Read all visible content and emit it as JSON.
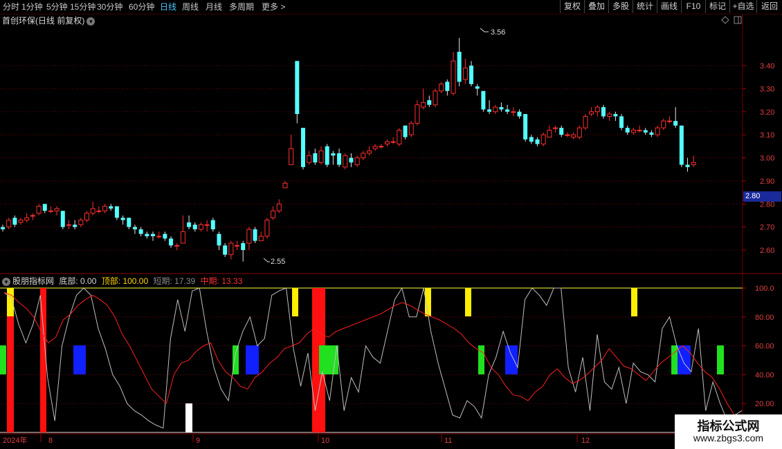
{
  "toolbar": {
    "periods": [
      "分时",
      "1分钟",
      "5分钟",
      "15分钟",
      "30分钟",
      "60分钟",
      "日线",
      "周线",
      "月线",
      "多周期",
      "更多 >"
    ],
    "active_period": "日线",
    "buttons": [
      "复权",
      "叠加",
      "多股",
      "统计",
      "画线",
      "F10",
      "标记",
      "+自选",
      "返回"
    ]
  },
  "stock_title": "首创环保(日线 前复权)",
  "price_axis": [
    "3.40",
    "3.30",
    "3.20",
    "3.10",
    "3.00",
    "2.90",
    "2.80",
    "2.70",
    "2.60"
  ],
  "current_price": "2.80",
  "annotations": {
    "high": "3.56",
    "low": "2.55"
  },
  "indicator": {
    "name": "股朋指标网",
    "bottom_label": "底部:",
    "bottom_value": "0.00",
    "top_label": "顶部:",
    "top_value": "100.00",
    "short_label": "短期:",
    "short_value": "17.39",
    "mid_label": "中期:",
    "mid_value": "13.33",
    "axis": [
      "100.0",
      "80.00",
      "60.00",
      "40.00",
      "20.00"
    ]
  },
  "date_axis": [
    "2024年",
    "8",
    "9",
    "10",
    "11",
    "12"
  ],
  "watermark": {
    "line1": "指标公式网",
    "line2": "www.zbgs3.com"
  },
  "colors": {
    "up": "#ff3030",
    "down": "#54ffff",
    "short_line": "#c0c0c0",
    "mid_line": "#ff2020",
    "accent": "#4fc3f7"
  },
  "candles": [
    [
      2.7,
      2.69,
      2.71,
      2.68
    ],
    [
      2.7,
      2.73,
      2.74,
      2.69
    ],
    [
      2.74,
      2.71,
      2.75,
      2.7
    ],
    [
      2.72,
      2.73,
      2.74,
      2.71
    ],
    [
      2.73,
      2.74,
      2.76,
      2.72
    ],
    [
      2.75,
      2.75,
      2.76,
      2.73
    ],
    [
      2.76,
      2.79,
      2.8,
      2.75
    ],
    [
      2.8,
      2.77,
      2.8,
      2.76
    ],
    [
      2.77,
      2.77,
      2.79,
      2.76
    ],
    [
      2.77,
      2.78,
      2.79,
      2.75
    ],
    [
      2.77,
      2.7,
      2.77,
      2.69
    ],
    [
      2.71,
      2.71,
      2.73,
      2.69
    ],
    [
      2.71,
      2.7,
      2.73,
      2.69
    ],
    [
      2.71,
      2.73,
      2.74,
      2.7
    ],
    [
      2.73,
      2.76,
      2.77,
      2.72
    ],
    [
      2.76,
      2.78,
      2.81,
      2.75
    ],
    [
      2.77,
      2.77,
      2.79,
      2.76
    ],
    [
      2.77,
      2.79,
      2.8,
      2.76
    ],
    [
      2.79,
      2.78,
      2.8,
      2.77
    ],
    [
      2.79,
      2.74,
      2.79,
      2.73
    ],
    [
      2.74,
      2.73,
      2.75,
      2.71
    ],
    [
      2.74,
      2.7,
      2.74,
      2.69
    ],
    [
      2.7,
      2.69,
      2.71,
      2.67
    ],
    [
      2.69,
      2.67,
      2.7,
      2.66
    ],
    [
      2.67,
      2.66,
      2.68,
      2.65
    ],
    [
      2.67,
      2.66,
      2.68,
      2.64
    ],
    [
      2.66,
      2.66,
      2.68,
      2.65
    ],
    [
      2.67,
      2.65,
      2.68,
      2.64
    ],
    [
      2.65,
      2.62,
      2.66,
      2.61
    ],
    [
      2.62,
      2.62,
      2.63,
      2.6
    ],
    [
      2.63,
      2.68,
      2.75,
      2.63
    ],
    [
      2.72,
      2.7,
      2.75,
      2.69
    ],
    [
      2.71,
      2.69,
      2.72,
      2.68
    ],
    [
      2.69,
      2.71,
      2.72,
      2.68
    ],
    [
      2.71,
      2.71,
      2.73,
      2.68
    ],
    [
      2.73,
      2.69,
      2.74,
      2.68
    ],
    [
      2.67,
      2.62,
      2.68,
      2.6
    ],
    [
      2.62,
      2.58,
      2.63,
      2.57
    ],
    [
      2.58,
      2.63,
      2.64,
      2.56
    ],
    [
      2.62,
      2.62,
      2.64,
      2.6
    ],
    [
      2.63,
      2.6,
      2.64,
      2.55
    ],
    [
      2.63,
      2.69,
      2.7,
      2.6
    ],
    [
      2.69,
      2.64,
      2.7,
      2.63
    ],
    [
      2.64,
      2.66,
      2.68,
      2.64
    ],
    [
      2.66,
      2.73,
      2.74,
      2.65
    ],
    [
      2.74,
      2.77,
      2.79,
      2.73
    ],
    [
      2.77,
      2.8,
      2.82,
      2.76
    ],
    [
      2.87,
      2.89,
      2.9,
      2.87
    ],
    [
      2.97,
      3.04,
      3.1,
      2.97
    ],
    [
      3.42,
      3.19,
      3.42,
      3.15
    ],
    [
      3.13,
      2.96,
      3.13,
      2.95
    ],
    [
      2.98,
      3.01,
      3.03,
      2.97
    ],
    [
      3.02,
      2.98,
      3.04,
      2.97
    ],
    [
      2.98,
      3.03,
      3.05,
      2.97
    ],
    [
      3.05,
      2.97,
      3.06,
      2.96
    ],
    [
      3.02,
      3.01,
      3.03,
      2.97
    ],
    [
      3.02,
      2.97,
      3.04,
      2.96
    ],
    [
      2.96,
      3.01,
      3.02,
      2.95
    ],
    [
      3.0,
      2.98,
      3.02,
      2.96
    ],
    [
      2.97,
      3.0,
      3.01,
      2.96
    ],
    [
      3.0,
      3.02,
      3.03,
      2.99
    ],
    [
      3.02,
      3.03,
      3.05,
      3.01
    ],
    [
      3.04,
      3.05,
      3.06,
      3.03
    ],
    [
      3.05,
      3.05,
      3.06,
      3.04
    ],
    [
      3.06,
      3.07,
      3.08,
      3.05
    ],
    [
      3.07,
      3.07,
      3.09,
      3.06
    ],
    [
      3.06,
      3.12,
      3.13,
      3.05
    ],
    [
      3.14,
      3.09,
      3.14,
      3.08
    ],
    [
      3.1,
      3.15,
      3.16,
      3.09
    ],
    [
      3.15,
      3.23,
      3.25,
      3.14
    ],
    [
      3.22,
      3.24,
      3.3,
      3.21
    ],
    [
      3.25,
      3.23,
      3.27,
      3.22
    ],
    [
      3.23,
      3.29,
      3.3,
      3.22
    ],
    [
      3.29,
      3.32,
      3.33,
      3.28
    ],
    [
      3.33,
      3.29,
      3.34,
      3.27
    ],
    [
      3.28,
      3.42,
      3.46,
      3.27
    ],
    [
      3.46,
      3.33,
      3.52,
      3.31
    ],
    [
      3.34,
      3.39,
      3.43,
      3.32
    ],
    [
      3.4,
      3.32,
      3.42,
      3.31
    ],
    [
      3.31,
      3.3,
      3.32,
      3.27
    ],
    [
      3.29,
      3.21,
      3.29,
      3.2
    ],
    [
      3.21,
      3.2,
      3.25,
      3.19
    ],
    [
      3.2,
      3.22,
      3.23,
      3.19
    ],
    [
      3.22,
      3.21,
      3.24,
      3.2
    ],
    [
      3.21,
      3.2,
      3.23,
      3.19
    ],
    [
      3.2,
      3.2,
      3.22,
      3.18
    ],
    [
      3.2,
      3.18,
      3.21,
      3.17
    ],
    [
      3.19,
      3.08,
      3.19,
      3.07
    ],
    [
      3.09,
      3.07,
      3.1,
      3.06
    ],
    [
      3.08,
      3.06,
      3.09,
      3.05
    ],
    [
      3.06,
      3.1,
      3.11,
      3.05
    ],
    [
      3.09,
      3.12,
      3.14,
      3.09
    ],
    [
      3.13,
      3.13,
      3.14,
      3.11
    ],
    [
      3.13,
      3.1,
      3.14,
      3.09
    ],
    [
      3.1,
      3.1,
      3.11,
      3.09
    ],
    [
      3.09,
      3.1,
      3.11,
      3.08
    ],
    [
      3.09,
      3.13,
      3.14,
      3.08
    ],
    [
      3.13,
      3.18,
      3.19,
      3.12
    ],
    [
      3.19,
      3.2,
      3.22,
      3.18
    ],
    [
      3.2,
      3.22,
      3.23,
      3.18
    ],
    [
      3.22,
      3.18,
      3.23,
      3.17
    ],
    [
      3.18,
      3.19,
      3.2,
      3.16
    ],
    [
      3.19,
      3.18,
      3.2,
      3.16
    ],
    [
      3.18,
      3.13,
      3.19,
      3.12
    ],
    [
      3.13,
      3.11,
      3.14,
      3.1
    ],
    [
      3.11,
      3.12,
      3.13,
      3.1
    ],
    [
      3.12,
      3.12,
      3.14,
      3.11
    ],
    [
      3.12,
      3.11,
      3.13,
      3.1
    ],
    [
      3.11,
      3.1,
      3.12,
      3.09
    ],
    [
      3.1,
      3.13,
      3.14,
      3.09
    ],
    [
      3.13,
      3.16,
      3.17,
      3.12
    ],
    [
      3.16,
      3.16,
      3.18,
      3.15
    ],
    [
      3.16,
      3.14,
      3.22,
      3.13
    ],
    [
      3.14,
      2.97,
      3.14,
      2.96
    ],
    [
      2.97,
      2.96,
      3.0,
      2.94
    ],
    [
      2.97,
      2.98,
      3.01,
      2.96
    ]
  ],
  "short_line": [
    97,
    93,
    75,
    62,
    75,
    95,
    38,
    8,
    60,
    80,
    95,
    100,
    95,
    72,
    58,
    40,
    32,
    20,
    15,
    12,
    8,
    5,
    3,
    65,
    92,
    70,
    98,
    100,
    70,
    45,
    30,
    22,
    55,
    70,
    80,
    60,
    65,
    95,
    98,
    100,
    58,
    32,
    55,
    15,
    42,
    22,
    60,
    15,
    38,
    28,
    60,
    52,
    48,
    70,
    92,
    100,
    80,
    80,
    100,
    70,
    48,
    30,
    12,
    10,
    22,
    18,
    10,
    40,
    52,
    70,
    55,
    45,
    92,
    100,
    95,
    88,
    100,
    100,
    45,
    28,
    52,
    15,
    68,
    35,
    30,
    45,
    20,
    48,
    42,
    40,
    35,
    72,
    80,
    60,
    48,
    42,
    72,
    15,
    35,
    20,
    8,
    12,
    15
  ],
  "mid_line": [
    97,
    95,
    90,
    86,
    80,
    70,
    62,
    66,
    78,
    82,
    88,
    92,
    95,
    92,
    88,
    80,
    68,
    60,
    50,
    40,
    30,
    25,
    20,
    40,
    48,
    50,
    56,
    60,
    62,
    50,
    42,
    38,
    32,
    30,
    38,
    42,
    48,
    52,
    58,
    60,
    62,
    68,
    72,
    68,
    66,
    70,
    72,
    74,
    76,
    78,
    80,
    82,
    85,
    88,
    90,
    88,
    85,
    82,
    80,
    78,
    75,
    72,
    68,
    62,
    58,
    55,
    45,
    40,
    32,
    26,
    25,
    22,
    28,
    32,
    40,
    44,
    38,
    34,
    36,
    40,
    45,
    50,
    58,
    52,
    46,
    44,
    40,
    36,
    42,
    48,
    52,
    56,
    60,
    55,
    48,
    42,
    38,
    30,
    20,
    12,
    5
  ]
}
